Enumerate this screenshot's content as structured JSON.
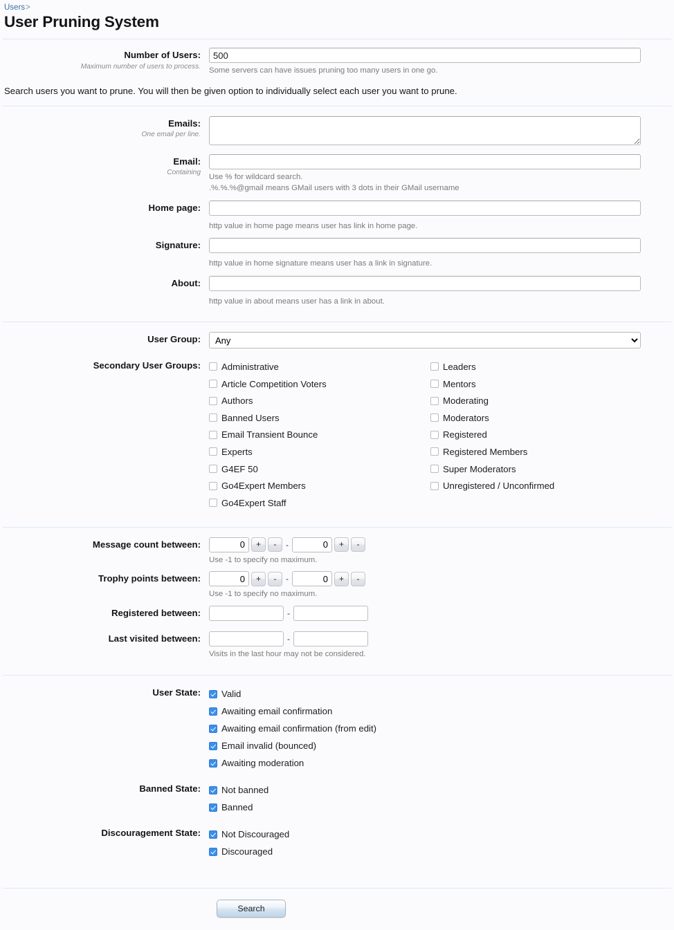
{
  "breadcrumb": {
    "root_label": "Users",
    "separator": ">"
  },
  "page_title": "User Pruning System",
  "colors": {
    "background": "#fbfbfd",
    "divider": "#dde9f3",
    "link": "#3a6ea5",
    "checkbox_checked": "#3d8ee8",
    "hint_text": "#7a7a7a"
  },
  "number_of_users": {
    "label": "Number of Users:",
    "sublabel": "Maximum number of users to process.",
    "value": "500",
    "hint": "Some servers can have issues pruning too many users in one go."
  },
  "notice": "Search users you want to prune. You will then be given option to individually select each user you want to prune.",
  "fields": {
    "emails": {
      "label": "Emails:",
      "sublabel": "One email per line.",
      "value": "",
      "placeholder": ""
    },
    "email": {
      "label": "Email:",
      "sublabel": "Containing",
      "value": "",
      "placeholder": "",
      "hint_line1": "Use % for wildcard search.",
      "hint_line2": ".%.%.%@gmail means GMail users with 3 dots in their GMail username"
    },
    "home_page": {
      "label": "Home page:",
      "value": "",
      "placeholder": "",
      "hint": "http value in home page means user has link in home page."
    },
    "signature": {
      "label": "Signature:",
      "value": "",
      "placeholder": "",
      "hint": "http value in home signature means user has a link in signature."
    },
    "about": {
      "label": "About:",
      "value": "",
      "placeholder": "",
      "hint": "http value in about means user has a link in about."
    }
  },
  "user_group": {
    "label": "User Group:",
    "selected": "Any",
    "options": [
      "Any"
    ]
  },
  "secondary_user_groups": {
    "label": "Secondary User Groups:",
    "column_left": [
      {
        "label": "Administrative",
        "checked": false
      },
      {
        "label": "Article Competition Voters",
        "checked": false
      },
      {
        "label": "Authors",
        "checked": false
      },
      {
        "label": "Banned Users",
        "checked": false
      },
      {
        "label": "Email Transient Bounce",
        "checked": false
      },
      {
        "label": "Experts",
        "checked": false
      },
      {
        "label": "G4EF 50",
        "checked": false
      },
      {
        "label": "Go4Expert Members",
        "checked": false
      },
      {
        "label": "Go4Expert Staff",
        "checked": false
      }
    ],
    "column_right": [
      {
        "label": "Leaders",
        "checked": false
      },
      {
        "label": "Mentors",
        "checked": false
      },
      {
        "label": "Moderating",
        "checked": false
      },
      {
        "label": "Moderators",
        "checked": false
      },
      {
        "label": "Registered",
        "checked": false
      },
      {
        "label": "Registered Members",
        "checked": false
      },
      {
        "label": "Super Moderators",
        "checked": false
      },
      {
        "label": "Unregistered / Unconfirmed",
        "checked": false
      }
    ]
  },
  "ranges": {
    "message_count": {
      "label": "Message count between:",
      "min_value": "0",
      "max_value": "0",
      "plus_label": "+",
      "minus_label": "-",
      "separator": "-",
      "hint": "Use -1 to specify no maximum."
    },
    "trophy_points": {
      "label": "Trophy points between:",
      "min_value": "0",
      "max_value": "0",
      "plus_label": "+",
      "minus_label": "-",
      "separator": "-",
      "hint": "Use -1 to specify no maximum."
    },
    "registered": {
      "label": "Registered between:",
      "from_value": "",
      "to_value": "",
      "separator": "-"
    },
    "last_visited": {
      "label": "Last visited between:",
      "from_value": "",
      "to_value": "",
      "separator": "-",
      "hint": "Visits in the last hour may not be considered."
    }
  },
  "user_state": {
    "label": "User State:",
    "items": [
      {
        "label": "Valid",
        "checked": true
      },
      {
        "label": "Awaiting email confirmation",
        "checked": true
      },
      {
        "label": "Awaiting email confirmation (from edit)",
        "checked": true
      },
      {
        "label": "Email invalid (bounced)",
        "checked": true
      },
      {
        "label": "Awaiting moderation",
        "checked": true
      }
    ]
  },
  "banned_state": {
    "label": "Banned State:",
    "items": [
      {
        "label": "Not banned",
        "checked": true
      },
      {
        "label": "Banned",
        "checked": true
      }
    ]
  },
  "discouragement_state": {
    "label": "Discouragement State:",
    "items": [
      {
        "label": "Not Discouraged",
        "checked": true
      },
      {
        "label": "Discouraged",
        "checked": true
      }
    ]
  },
  "submit": {
    "label": "Search"
  }
}
